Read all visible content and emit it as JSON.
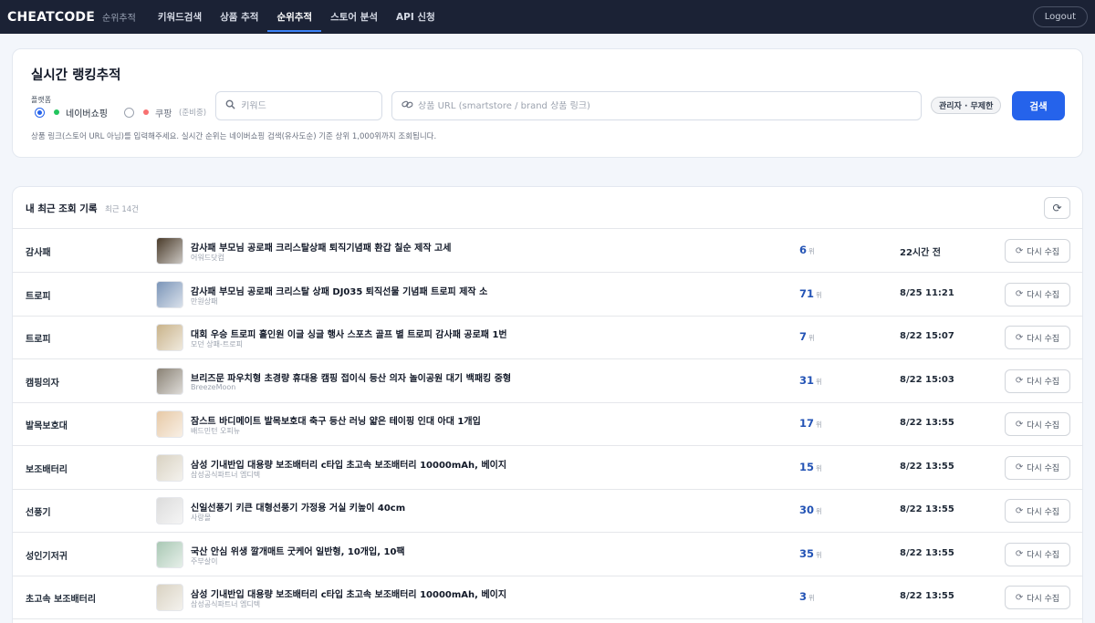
{
  "nav": {
    "brand": "CHEATCODE",
    "brand_sub": "순위추적",
    "links": [
      "키워드검색",
      "상품 추적",
      "순위추적",
      "스토어 분석",
      "API 신청"
    ],
    "active_index": 2,
    "logout": "Logout"
  },
  "search": {
    "title": "실시간 랭킹추적",
    "platform_label": "플랫폼",
    "platforms": [
      {
        "label": "네이버쇼핑",
        "selected": true,
        "color": "#22c55e"
      },
      {
        "label": "쿠팡",
        "sub": "(준비중)",
        "selected": false,
        "color": "#f87171"
      }
    ],
    "keyword_placeholder": "키워드",
    "url_placeholder": "상품 URL (smartstore / brand 상품 링크)",
    "badge": "관리자 · 무제한",
    "button": "검색",
    "help": "상품 링크(스토어 URL 아님)를 입력해주세요. 실시간 순위는 네이버쇼핑 검색(유사도순) 기준 상위 1,000위까지 조회됩니다."
  },
  "history": {
    "title": "내 최근 조회 기록",
    "count": "최근 14건",
    "rank_unit": "위",
    "recollect_label": "다시 수집",
    "rows": [
      {
        "keyword": "감사패",
        "product": "감사패 부모님 공로패 크리스탈상패 퇴직기념패 환갑 칠순 제작 고세",
        "store": "어워드닷컴",
        "rank": "6",
        "time": "22시간 전",
        "thumb": "#4a3b2a"
      },
      {
        "keyword": "트로피",
        "product": "감사패 부모님 공로패 크리스탈 상패 DJ035 퇴직선물 기념패 트로피 제작 소",
        "store": "만원상패",
        "rank": "71",
        "time": "8/25 11:21",
        "thumb": "#7b95b8"
      },
      {
        "keyword": "트로피",
        "product": "대회 우승 트로피 홀인원 이글 싱글 행사 스포츠 골프 별 트로피 감사패 공로패 1번",
        "store": "모던 상패-트로피",
        "rank": "7",
        "time": "8/22 15:07",
        "thumb": "#c9b38a"
      },
      {
        "keyword": "캠핑의자",
        "product": "브리즈문 파우치형 초경량 휴대용 캠핑 접이식 등산 의자 놀이공원 대기 백패킹 중형",
        "store": "BreezeMoon",
        "rank": "31",
        "time": "8/22 15:03",
        "thumb": "#8a8275"
      },
      {
        "keyword": "발목보호대",
        "product": "잠스트 바디메이트 발목보호대 축구 등산 러닝 얇은 테이핑 인대 아대 1개입",
        "store": "배드민턴 오피뉴",
        "rank": "17",
        "time": "8/22 13:55",
        "thumb": "#e7c9a6"
      },
      {
        "keyword": "보조배터리",
        "product": "삼성 기내반입 대용량 보조배터리 c타입 초고속 보조배터리 10000mAh, 베이지",
        "store": "삼성공식파트너 엠디텍",
        "rank": "15",
        "time": "8/22 13:55",
        "thumb": "#d9d2c2"
      },
      {
        "keyword": "선풍기",
        "product": "신일선풍기 키큰 대형선풍기 가정용 거실 키높이 40cm",
        "store": "사랑몰",
        "rank": "30",
        "time": "8/22 13:55",
        "thumb": "#dcdcdc"
      },
      {
        "keyword": "성인기저귀",
        "product": "국산 안심 위생 깔개매트 굿케어 일반형, 10개입, 10팩",
        "store": "주부살이",
        "rank": "35",
        "time": "8/22 13:55",
        "thumb": "#a9c8b4"
      },
      {
        "keyword": "초고속 보조배터리",
        "product": "삼성 기내반입 대용량 보조배터리 c타입 초고속 보조배터리 10000mAh, 베이지",
        "store": "삼성공식파트너 엠디텍",
        "rank": "3",
        "time": "8/22 13:55",
        "thumb": "#d9d2c2"
      }
    ]
  }
}
